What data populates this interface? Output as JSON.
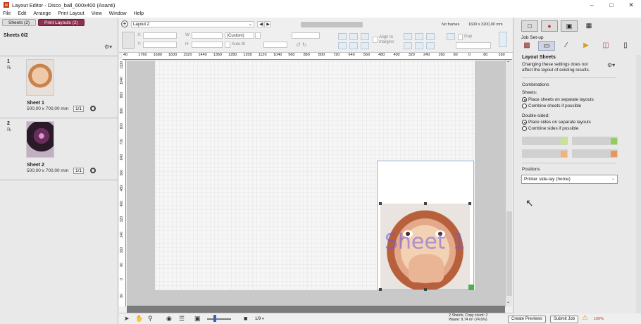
{
  "window": {
    "title": "Layout Editor - Disco_ball_600x400 (Asanti)"
  },
  "menu": [
    "File",
    "Edit",
    "Arrange",
    "Print Layout",
    "View",
    "Window",
    "Help"
  ],
  "left_panel": {
    "tabs": [
      {
        "label": "Sheets (2)"
      },
      {
        "label": "Print Layouts (2)"
      }
    ],
    "sheets_count": "Sheets 0/2",
    "sheets": [
      {
        "num": "1",
        "name": "Sheet 1",
        "size": "500,00 x 700,00 mm",
        "ratio": "1/1"
      },
      {
        "num": "2",
        "name": "Sheet 2",
        "size": "500,00 x 700,00 mm",
        "ratio": "1/1"
      }
    ]
  },
  "toolbar": {
    "layout_select": "Layout 2",
    "w_label": "W:",
    "h_label": "H:",
    "x_label": "X:",
    "y_label": "Y:",
    "custom_select": "(Custom)",
    "autofit": "Auto-fit",
    "align_to_margins": "Align to margins",
    "gap": "Gap",
    "frames_info": "No frames",
    "frames_size": "1600 x 3200,00 mm"
  },
  "ruler_top": [
    "40",
    "1760",
    "1680",
    "1600",
    "1520",
    "1440",
    "1360",
    "1280",
    "1200",
    "1120",
    "1040",
    "960",
    "880",
    "800",
    "720",
    "640",
    "560",
    "480",
    "400",
    "320",
    "240",
    "160",
    "80",
    "0",
    "80",
    "160"
  ],
  "ruler_left": [
    "1100",
    "1040",
    "960",
    "880",
    "800",
    "720",
    "640",
    "560",
    "480",
    "400",
    "320",
    "240",
    "160",
    "80",
    "0",
    "80"
  ],
  "canvas": {
    "watermark": "Sheet 1"
  },
  "right_panel": {
    "job_setup": "Job Set-up",
    "heading": "Layout Sheets",
    "notice": "Changing these settings does not affect the layout of existing results.",
    "combinations": "Combinations",
    "sheets_label": "Sheets:",
    "sheet_options": [
      {
        "label": "Place sheets on separate layouts",
        "selected": true
      },
      {
        "label": "Combine sheets if possible",
        "selected": false
      }
    ],
    "double_sided_label": "Double-sided:",
    "side_options": [
      {
        "label": "Place sides on separate layouts",
        "selected": true
      },
      {
        "label": "Combine sides if possible",
        "selected": false
      }
    ],
    "positions_label": "Positions",
    "positions_value": "Printer side-lay (home)"
  },
  "bottom": {
    "page_indicator": "1/9",
    "status_line1": "2 Sheets, Copy count: 2",
    "status_line2": "Waste: 9,74 m² (74,6%)",
    "create_previews": "Create Previews",
    "submit_job": "Submit Job",
    "zoom": "100%"
  },
  "colors": {
    "accent_tab": "#8a3050",
    "watermark": "#6e5ae6",
    "warning": "#e0a400"
  }
}
